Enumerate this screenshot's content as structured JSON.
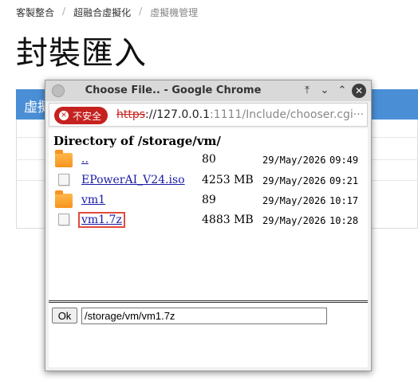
{
  "background": {
    "breadcrumb": [
      "客製整合",
      "超融合虛擬化",
      "虛擬機管理"
    ],
    "page_title": "封裝匯入",
    "panel_title": "虛擬"
  },
  "popup": {
    "title": "Choose File.. - Google Chrome",
    "controls": {
      "pin": "⤒",
      "minimize": "⌄",
      "maximize": "⌃",
      "close": "✕"
    },
    "insecure_label": "不安全",
    "url": {
      "scheme": "https",
      "host": "://127.0.0.1",
      "rest": ":1111/Include/chooser.cgi···"
    },
    "directory_heading": "Directory of /storage/vm/",
    "entries": [
      {
        "name": "..",
        "type": "folder",
        "size": "80",
        "date": "29/May/2026",
        "time": "09:49"
      },
      {
        "name": "EPowerAI_V24.iso",
        "type": "file",
        "size": "4253 MB",
        "date": "29/May/2026",
        "time": "09:21"
      },
      {
        "name": "vm1",
        "type": "folder",
        "size": "89",
        "date": "29/May/2026",
        "time": "10:17"
      },
      {
        "name": "vm1.7z",
        "type": "file",
        "size": "4883 MB",
        "date": "29/May/2026",
        "time": "10:28",
        "selected": true
      }
    ],
    "ok_label": "Ok",
    "path_value": "/storage/vm/vm1.7z"
  },
  "colors": {
    "insecure": "#c5221f",
    "link": "#1a1aa6",
    "selection": "#e04b3b",
    "panel_header": "#4a8fd6"
  }
}
